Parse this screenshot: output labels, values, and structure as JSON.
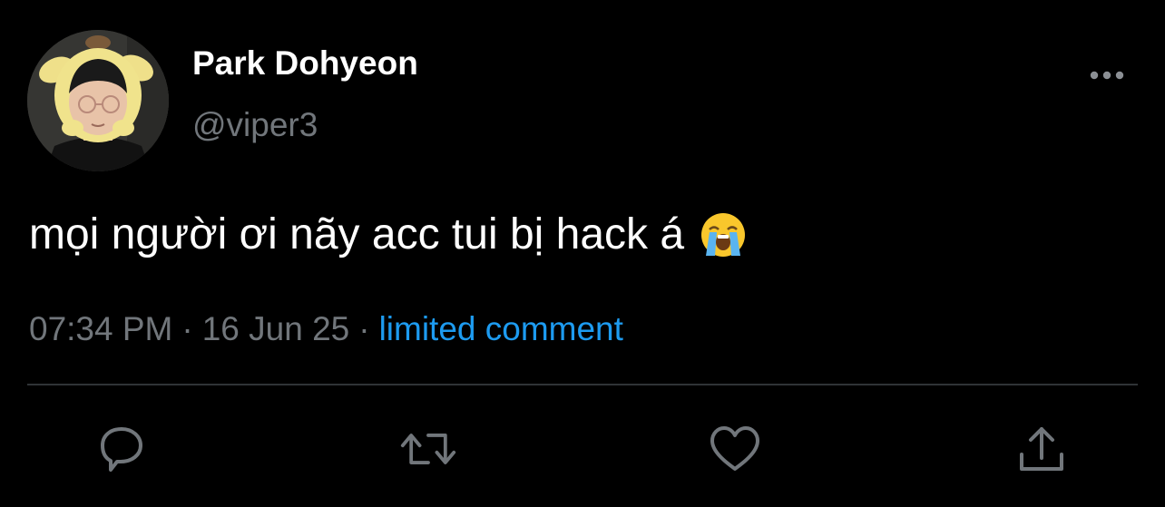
{
  "author": {
    "display_name": "Park Dohyeon",
    "handle": "@viper3",
    "avatar": "avatar-photo"
  },
  "tweet": {
    "text": "mọi người ơi nãy acc tui bị hack á",
    "emoji": "loudly-crying-face-emoji",
    "time": "07:34 PM",
    "separator": "·",
    "date": "16 Jun 25",
    "reply_setting": "limited comment"
  },
  "actions": {
    "reply": "reply-icon",
    "retweet": "retweet-icon",
    "like": "heart-icon",
    "share": "share-icon"
  },
  "colors": {
    "background": "#000000",
    "primary_text": "#ffffff",
    "secondary_text": "#71767b",
    "accent": "#1d9bf0",
    "divider": "#2f3336"
  }
}
